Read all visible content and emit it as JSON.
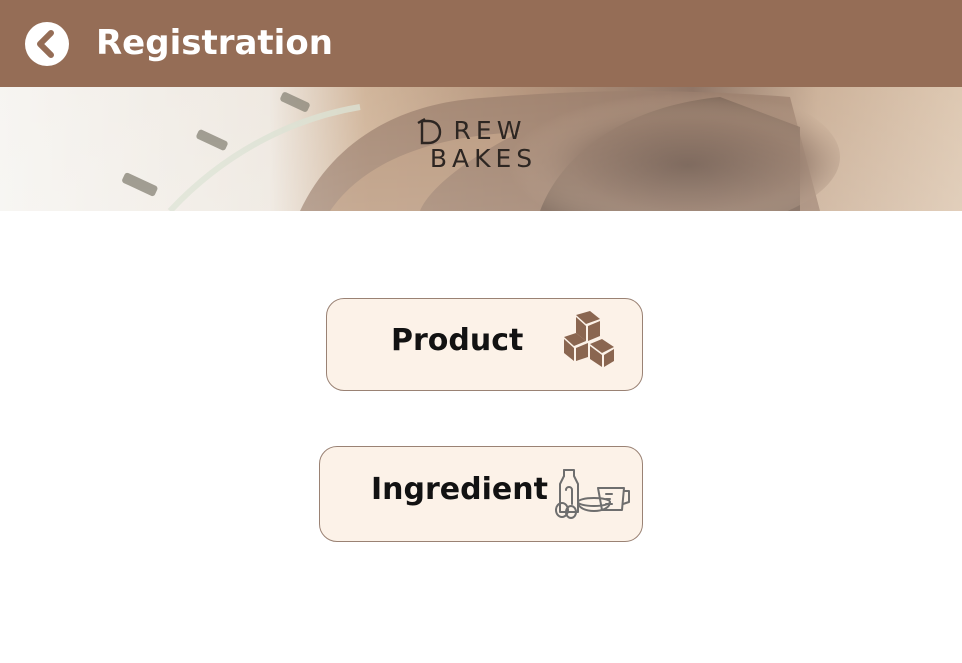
{
  "header": {
    "title": "Registration",
    "back_icon": "chevron-left-icon"
  },
  "banner": {
    "logo_line1": " REW",
    "logo_line2": "BAKES"
  },
  "buttons": {
    "product_label": "Product",
    "product_icon": "boxes-icon",
    "ingredient_label": "Ingredient",
    "ingredient_icon": "baking-ingredients-icon"
  },
  "colors": {
    "header": "#956d56",
    "button_fill": "#fcf2e8",
    "button_border": "#9a8274",
    "icon": "#8a6650"
  }
}
